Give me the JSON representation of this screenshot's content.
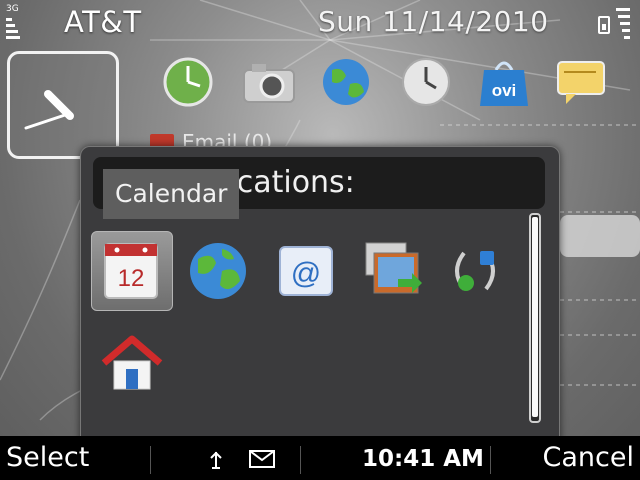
{
  "status_bar": {
    "signal_label": "3G",
    "operator": "AT&T",
    "datetime": "Sun 11/14/2010"
  },
  "home": {
    "clock_widget": "analog clock",
    "shortcuts": [
      {
        "icon": "clock-icon"
      },
      {
        "icon": "camera-icon"
      },
      {
        "icon": "globe-icon"
      },
      {
        "icon": "alarm-clock-icon"
      },
      {
        "icon": "ovi-store-icon",
        "label": "ovi"
      },
      {
        "icon": "messaging-icon"
      }
    ],
    "email_notice": "Email (0)"
  },
  "dialog": {
    "title": "plications:",
    "tooltip": "Calendar",
    "apps": [
      {
        "icon": "calendar-icon",
        "label": "12",
        "selected": true
      },
      {
        "icon": "globe-icon"
      },
      {
        "icon": "email-icon",
        "label": "@"
      },
      {
        "icon": "photos-icon"
      },
      {
        "icon": "ovi-sync-icon"
      },
      {
        "icon": "home-icon"
      }
    ]
  },
  "softkeys": {
    "left": "Select",
    "right": "Cancel",
    "time": "10:41 AM"
  }
}
